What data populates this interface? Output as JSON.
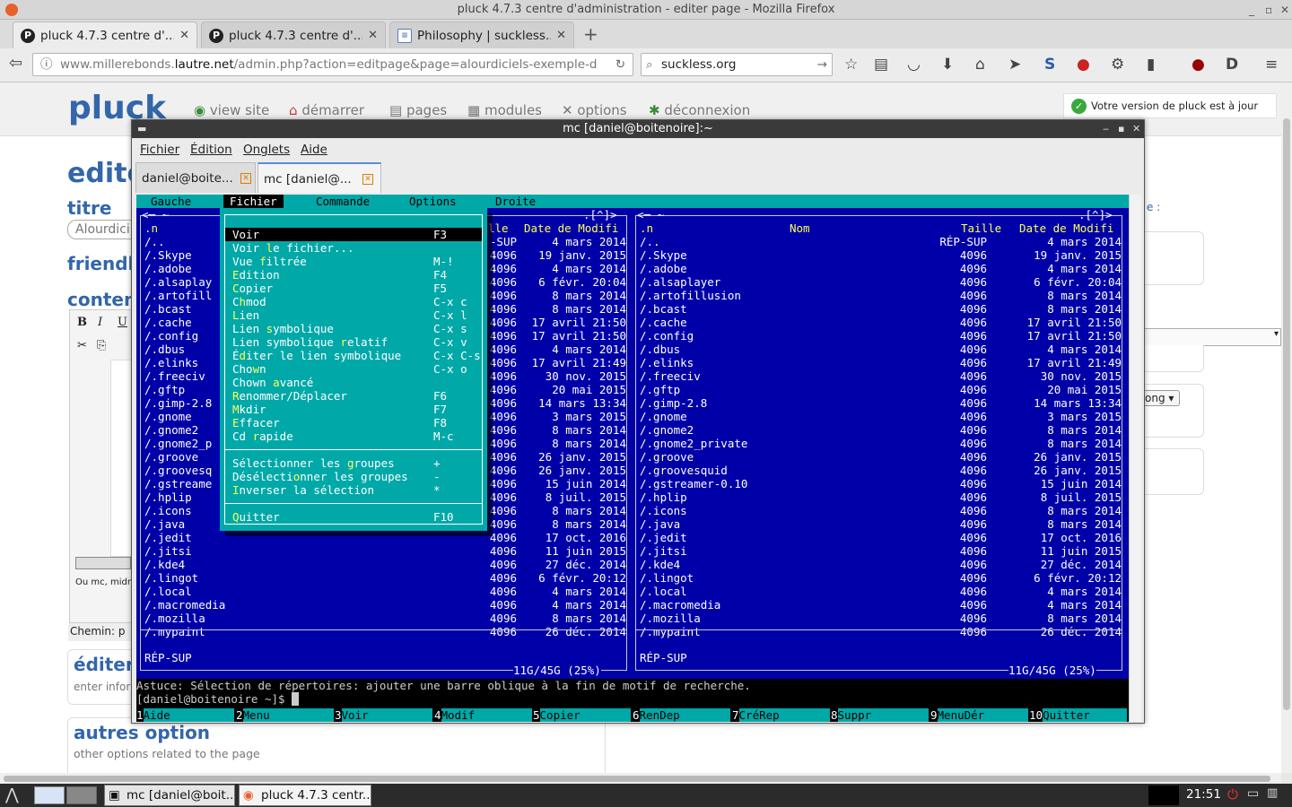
{
  "browser": {
    "window_title": "pluck 4.7.3 centre d'administration - editer page - Mozilla Firefox",
    "tabs": [
      {
        "label": "pluck 4.7.3 centre d'...",
        "icon": "P"
      },
      {
        "label": "pluck 4.7.3 centre d'...",
        "icon": "P"
      },
      {
        "label": "Philosophy | suckless...",
        "icon": "≡"
      }
    ],
    "url_prefix": "www.millerebonds.",
    "url_domain": "lautre.net",
    "url_suffix": "/admin.php?action=editpage&page=alourdiciels-exemple-d",
    "search_value": "suckless.org"
  },
  "pluck": {
    "logo": "pluck",
    "nav": [
      "view site",
      "démarrer",
      "pages",
      "modules",
      "options",
      "déconnexion"
    ],
    "update_status": "Votre version de pluck est à jour",
    "heading_edit": "edite",
    "label_title": "titre",
    "title_value": "Alourdici",
    "label_friendly": "friendl",
    "label_content": "conten",
    "path_label": "Chemin: p",
    "section_edit": "éditer",
    "section_edit_desc": "enter infor",
    "section_other": "autres option",
    "section_other_desc": "other options related to the page",
    "editor_text": "Ou mc, midnig",
    "right_label": "e :",
    "select_value": "ong"
  },
  "terminal": {
    "title": "mc [daniel@boitenoire]:~",
    "menu": [
      "Fichier",
      "Édition",
      "Onglets",
      "Aide"
    ],
    "tabs": [
      "daniel@boite...",
      "mc [daniel@..."
    ]
  },
  "mc": {
    "topmenu": [
      "Gauche",
      "Fichier",
      "Commande",
      "Options",
      "Droite"
    ],
    "right_headers": {
      "name": "Nom",
      "size": "Taille",
      "date": "Date de Modifi"
    },
    "left_headers": {
      "size": "lle",
      "date": "Date de Modifi"
    },
    "frame_corner": ".[^]>",
    "frame_left": "<─ ~",
    "files": [
      {
        "name": "/..",
        "size": "RÉP-SUP",
        "date": "4 mars 2014"
      },
      {
        "name": "/.Skype",
        "size": "4096",
        "date": "19 janv. 2015"
      },
      {
        "name": "/.adobe",
        "size": "4096",
        "date": "4 mars 2014"
      },
      {
        "name": "/.alsaplayer",
        "size": "4096",
        "date": "6 févr. 20:04"
      },
      {
        "name": "/.artofillusion",
        "size": "4096",
        "date": "8 mars 2014"
      },
      {
        "name": "/.bcast",
        "size": "4096",
        "date": "8 mars 2014"
      },
      {
        "name": "/.cache",
        "size": "4096",
        "date": "17 avril 21:50"
      },
      {
        "name": "/.config",
        "size": "4096",
        "date": "17 avril 21:50"
      },
      {
        "name": "/.dbus",
        "size": "4096",
        "date": "4 mars 2014"
      },
      {
        "name": "/.elinks",
        "size": "4096",
        "date": "17 avril 21:49"
      },
      {
        "name": "/.freeciv",
        "size": "4096",
        "date": "30 nov. 2015"
      },
      {
        "name": "/.gftp",
        "size": "4096",
        "date": "20 mai 2015"
      },
      {
        "name": "/.gimp-2.8",
        "size": "4096",
        "date": "14 mars 13:34"
      },
      {
        "name": "/.gnome",
        "size": "4096",
        "date": "3 mars 2015"
      },
      {
        "name": "/.gnome2",
        "size": "4096",
        "date": "8 mars 2014"
      },
      {
        "name": "/.gnome2_private",
        "size": "4096",
        "date": "8 mars 2014"
      },
      {
        "name": "/.groove",
        "size": "4096",
        "date": "26 janv. 2015"
      },
      {
        "name": "/.groovesquid",
        "size": "4096",
        "date": "26 janv. 2015"
      },
      {
        "name": "/.gstreamer-0.10",
        "size": "4096",
        "date": "15 juin 2014"
      },
      {
        "name": "/.hplip",
        "size": "4096",
        "date": "8 juil. 2015"
      },
      {
        "name": "/.icons",
        "size": "4096",
        "date": "8 mars 2014"
      },
      {
        "name": "/.java",
        "size": "4096",
        "date": "8 mars 2014"
      },
      {
        "name": "/.jedit",
        "size": "4096",
        "date": "17 oct. 2016"
      },
      {
        "name": "/.jitsi",
        "size": "4096",
        "date": "11 juin 2015"
      },
      {
        "name": "/.kde4",
        "size": "4096",
        "date": "27 déc. 2014"
      },
      {
        "name": "/.lingot",
        "size": "4096",
        "date": "6 févr. 20:12"
      },
      {
        "name": "/.local",
        "size": "4096",
        "date": "4 mars 2014"
      },
      {
        "name": "/.macromedia",
        "size": "4096",
        "date": "4 mars 2014"
      },
      {
        "name": "/.mozilla",
        "size": "4096",
        "date": "8 mars 2014"
      },
      {
        "name": "/.mypaint",
        "size": "4096",
        "date": "26 déc. 2014"
      }
    ],
    "left_names": [
      "/..",
      "/.Skype",
      "/.adobe",
      "/.alsaplay",
      "/.artofill",
      "/.bcast",
      "/.cache",
      "/.config",
      "/.dbus",
      "/.elinks",
      "/.freeciv",
      "/.gftp",
      "/.gimp-2.8",
      "/.gnome",
      "/.gnome2",
      "/.gnome2_p",
      "/.groove",
      "/.groovesq",
      "/.gstreame",
      "/.hplip",
      "/.icons",
      "/.java",
      "/.jedit",
      "/.jitsi",
      "/.kde4",
      "/.lingot",
      "/.local",
      "/.macromedia",
      "/.mozilla",
      "/.mypaint"
    ],
    "left_sizes": [
      "-SUP",
      "4096",
      "4096",
      "4096",
      "4096",
      "4096",
      "4096",
      "4096",
      "4096",
      "4096",
      "4096",
      "4096",
      "4096",
      "4096",
      "4096",
      "4096",
      "4096",
      "4096",
      "4096",
      "4096",
      "4096",
      "4096",
      "4096",
      "4096",
      "4096",
      "4096",
      "4096",
      "4096",
      "4096",
      "4096"
    ],
    "left_dates": [
      "4 mars 2014",
      "19 janv. 2015",
      "4 mars 2014",
      "6 févr. 20:04",
      "8 mars 2014",
      "8 mars 2014",
      "17 avril 21:50",
      "17 avril 21:50",
      "4 mars 2014",
      "17 avril 21:49",
      "30 nov. 2015",
      "20 mai 2015",
      "14 mars 13:34",
      "3 mars 2015",
      "8 mars 2014",
      "8 mars 2014",
      "26 janv. 2015",
      "26 janv. 2015",
      "15 juin 2014",
      "8 juil. 2015",
      "8 mars 2014",
      "8 mars 2014",
      "17 oct. 2016",
      "11 juin 2015",
      "27 déc. 2014",
      "6 févr. 20:12",
      "4 mars 2014",
      "4 mars 2014",
      "8 mars 2014",
      "26 déc. 2014"
    ],
    "first_row": ".n",
    "status": "RÉP-SUP",
    "disk": "11G/45G (25%)",
    "hint": "Astuce: Sélection de répertoires: ajouter une barre oblique à la fin de motif de recherche.",
    "prompt": "[daniel@boitenoire ~]$ ",
    "dropdown": [
      {
        "label": "Voir",
        "key": "F3",
        "hot": 0,
        "selected": true
      },
      {
        "label": "Voir le fichier...",
        "key": "",
        "hot": 5
      },
      {
        "label": "Vue filtrée",
        "key": "M-!",
        "hot": 4
      },
      {
        "label": "Edition",
        "key": "F4",
        "hot": 0
      },
      {
        "label": "Copier",
        "key": "F5",
        "hot": 0
      },
      {
        "label": "Chmod",
        "key": "C-x c",
        "hot": 1
      },
      {
        "label": "Lien",
        "key": "C-x l",
        "hot": 0
      },
      {
        "label": "Lien symbolique",
        "key": "C-x s",
        "hot": 5
      },
      {
        "label": "Lien symbolique relatif",
        "key": "C-x v",
        "hot": 16
      },
      {
        "label": "Éditer le lien symbolique",
        "key": "C-x C-s",
        "hot": 1
      },
      {
        "label": "Chown",
        "key": "C-x o",
        "hot": 3
      },
      {
        "label": "Chown avancé",
        "key": "",
        "hot": 6
      },
      {
        "label": "Renommer/Déplacer",
        "key": "F6",
        "hot": 0
      },
      {
        "label": "Mkdir",
        "key": "F7",
        "hot": 0
      },
      {
        "label": "Effacer",
        "key": "F8",
        "hot": 0
      },
      {
        "label": "Cd rapide",
        "key": "M-c",
        "hot": 3
      },
      {
        "sep": true
      },
      {
        "label": "Sélectionner les groupes",
        "key": "+",
        "hot": 17
      },
      {
        "label": "Désélectionner les groupes",
        "key": "-",
        "hot": 9
      },
      {
        "label": "Inverser la sélection",
        "key": "*",
        "hot": 0
      },
      {
        "sep": true
      },
      {
        "label": "Quitter",
        "key": "F10",
        "hot": 0
      }
    ],
    "fkeys": [
      {
        "n": "1",
        "l": "Aide"
      },
      {
        "n": "2",
        "l": "Menu"
      },
      {
        "n": "3",
        "l": "Voir"
      },
      {
        "n": "4",
        "l": "Modif"
      },
      {
        "n": "5",
        "l": "Copier"
      },
      {
        "n": "6",
        "l": "RenDep"
      },
      {
        "n": "7",
        "l": "CréRep"
      },
      {
        "n": "8",
        "l": "Suppr"
      },
      {
        "n": "9",
        "l": "MenuDér"
      },
      {
        "n": "10",
        "l": "Quitter"
      }
    ]
  },
  "taskbar": {
    "tasks": [
      "mc [daniel@boit...",
      "pluck 4.7.3 centr..."
    ],
    "clock": "21:51"
  },
  "colors": {
    "mc_blue": "#0000a8",
    "mc_cyan": "#00a8a8",
    "mc_yellow": "#ffff54",
    "pluck_blue": "#3366aa"
  }
}
